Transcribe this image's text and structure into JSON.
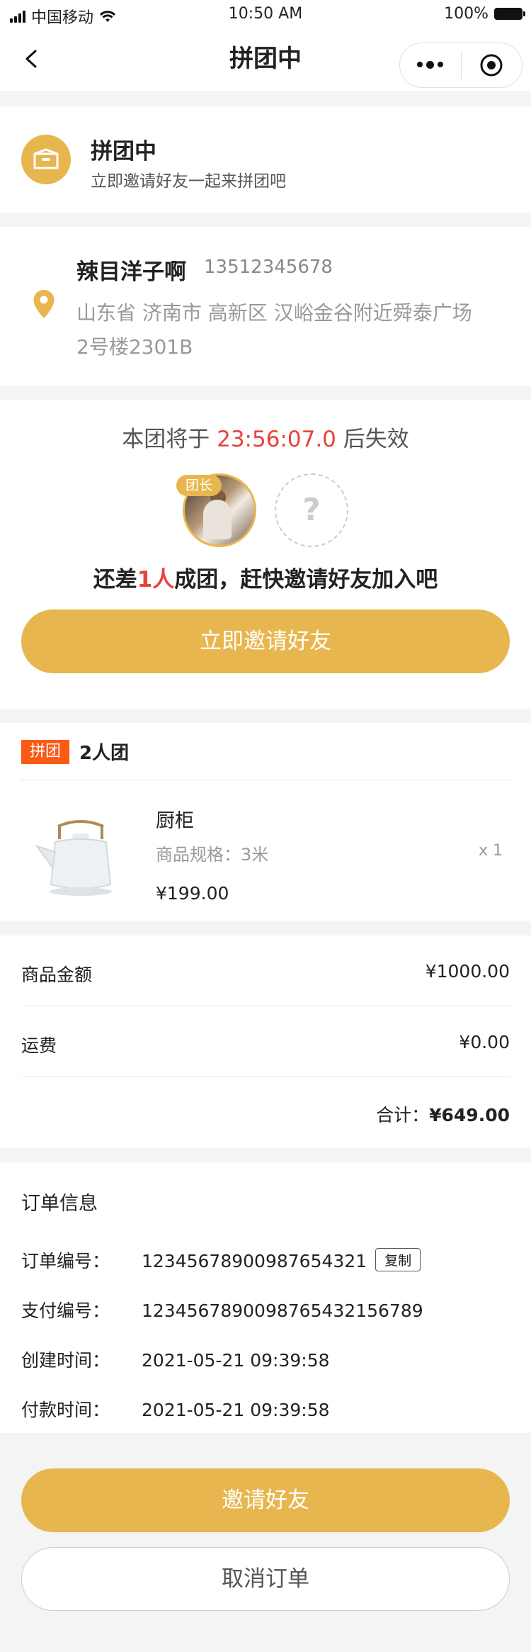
{
  "status_bar": {
    "carrier": "中国移动",
    "time": "10:50 AM",
    "battery": "100%"
  },
  "nav": {
    "title": "拼团中"
  },
  "group_status": {
    "title": "拼团中",
    "subtitle": "立即邀请好友一起来拼团吧"
  },
  "address": {
    "name": "辣目洋子啊",
    "phone": "13512345678",
    "detail": "山东省 济南市 高新区 汉峪金谷附近舜泰广场2号楼2301B"
  },
  "group": {
    "countdown_prefix": "本团将于",
    "countdown_time": "23:56:07.0",
    "countdown_suffix": "后失效",
    "leader_badge": "团长",
    "empty_slot": "?",
    "need_prefix": "还差",
    "need_count": "1人",
    "need_suffix": "成团，赶快邀请好友加入吧",
    "invite_button": "立即邀请好友"
  },
  "product": {
    "tag": "拼团",
    "group_size": "2人团",
    "name": "厨柜",
    "spec": "商品规格：3米",
    "qty": "x 1",
    "price": "¥199.00"
  },
  "amount": {
    "goods_label": "商品金额",
    "goods_value": "¥1000.00",
    "shipping_label": "运费",
    "shipping_value": "¥0.00",
    "total_label": "合计：",
    "total_value": "¥649.00"
  },
  "order": {
    "title": "订单信息",
    "rows": [
      {
        "label": "订单编号：",
        "value": "12345678900987654321"
      },
      {
        "label": "支付编号：",
        "value": "123456789009876543215678 9"
      },
      {
        "label": "创建时间：",
        "value": "2021-05-21 09:39:58"
      },
      {
        "label": "付款时间：",
        "value": "2021-05-21 09:39:58"
      }
    ],
    "copy_button": "复制"
  },
  "actions": {
    "invite": "邀请好友",
    "cancel": "取消订单"
  },
  "colors": {
    "accent": "#e8b64e",
    "highlight": "#e8433b",
    "tag": "#fa5a14"
  }
}
